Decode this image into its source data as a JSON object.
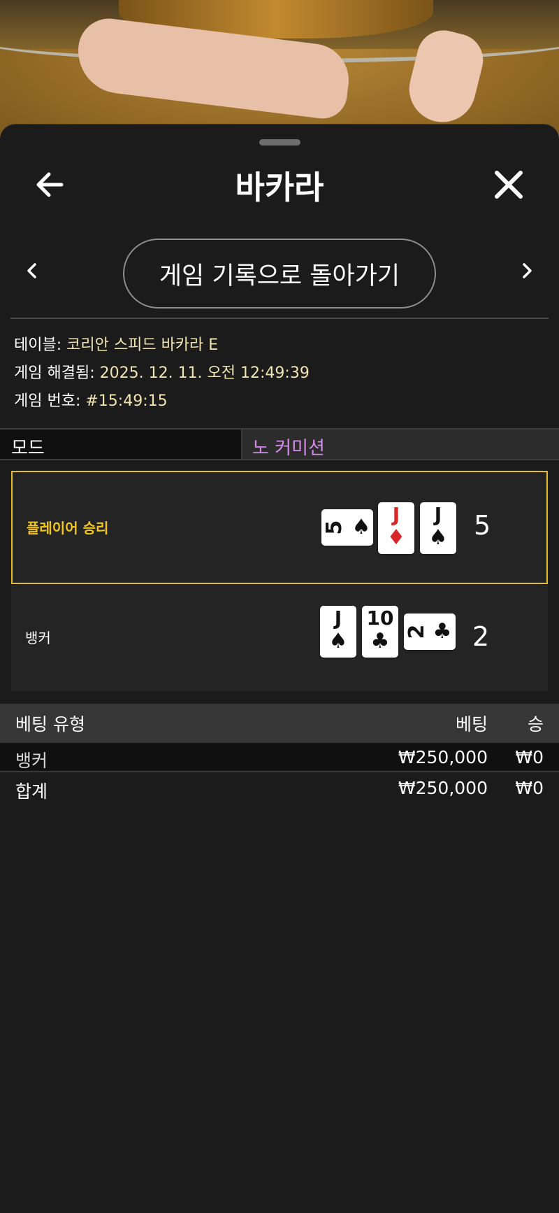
{
  "header": {
    "title": "바카라",
    "back_icon": "arrow-left-icon",
    "close_icon": "close-icon"
  },
  "nav": {
    "back_to_history_label": "게임 기록으로 돌아가기",
    "prev_icon": "chevron-left-icon",
    "next_icon": "chevron-right-icon"
  },
  "info": {
    "table_label": "테이블: ",
    "table_value": "코리안 스피드 바카라 E",
    "resolved_label": "게임 해결됨: ",
    "resolved_value": "2025. 12. 11. 오전 12:49:39",
    "game_no_label": "게임 번호: ",
    "game_no_value": "#15:49:15"
  },
  "mode": {
    "label": "모드",
    "value": "노 커미션"
  },
  "results": {
    "player": {
      "label": "플레이어 승리",
      "score": "5",
      "cards": [
        {
          "rank": "5",
          "suit": "♠",
          "color": "black",
          "orientation": "horizontal"
        },
        {
          "rank": "J",
          "suit": "♦",
          "color": "red",
          "orientation": "vertical"
        },
        {
          "rank": "J",
          "suit": "♠",
          "color": "black",
          "orientation": "vertical"
        }
      ]
    },
    "banker": {
      "label": "뱅커",
      "score": "2",
      "cards": [
        {
          "rank": "J",
          "suit": "♠",
          "color": "black",
          "orientation": "vertical"
        },
        {
          "rank": "10",
          "suit": "♣",
          "color": "black",
          "orientation": "vertical"
        },
        {
          "rank": "2",
          "suit": "♣",
          "color": "black",
          "orientation": "horizontal"
        }
      ]
    }
  },
  "bets": {
    "headers": {
      "type": "베팅 유형",
      "bet": "베팅",
      "win": "승"
    },
    "rows": [
      {
        "type": "뱅커",
        "bet": "₩250,000",
        "win": "₩0"
      }
    ],
    "total": {
      "type": "합계",
      "bet": "₩250,000",
      "win": "₩0"
    }
  },
  "colors": {
    "winner_border": "#e2be2b",
    "winner_label": "#f3c51f",
    "info_value": "#f1e3b0",
    "mode_value": "#d58ce8",
    "red_suit": "#d8262a"
  }
}
